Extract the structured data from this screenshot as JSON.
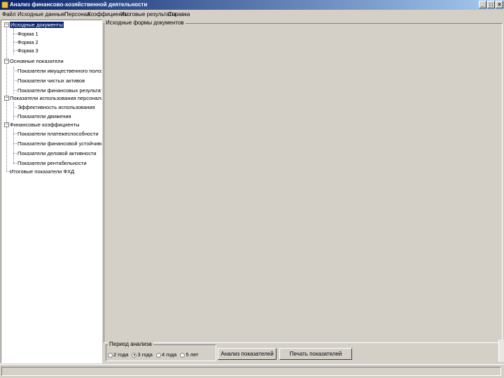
{
  "window": {
    "title": "Анализ финансово-хозяйственной деятельности",
    "minimize": "_",
    "maximize": "□",
    "close": "×"
  },
  "menu": [
    "Файл",
    "Исходные данные",
    "Персонал",
    "Коэффициенты",
    "Итоговые результаты",
    "Справка"
  ],
  "tree": {
    "nodes": [
      {
        "label": "Исходные документы"
      },
      {
        "label": "Форма 1"
      },
      {
        "label": "Форма 2"
      },
      {
        "label": "Форма 3"
      },
      {
        "label": "Основные показатели"
      },
      {
        "label": "Показатели имущественного положения"
      },
      {
        "label": "Показатели чистых активов"
      },
      {
        "label": "Показатели финансовых результатов"
      },
      {
        "label": "Показатели использования персонала"
      },
      {
        "label": "Эффективность использования"
      },
      {
        "label": "Показатели движения"
      },
      {
        "label": "Финансовые коэффициенты"
      },
      {
        "label": "Показатели платежеспособности"
      },
      {
        "label": "Показатели финансовой устойчивости"
      },
      {
        "label": "Показатели деловой активности"
      },
      {
        "label": "Показатели рентабельности"
      },
      {
        "label": "Итоговые показатели ФХД"
      }
    ]
  },
  "main": {
    "group_title": "Исходные формы документов"
  },
  "period": {
    "title": "Период анализа",
    "options": [
      "2 года",
      "3 года",
      "4 года",
      "5 лет"
    ],
    "selected_index": 1
  },
  "buttons": {
    "analyze": "Анализ показателей",
    "print": "Печать показателей"
  }
}
